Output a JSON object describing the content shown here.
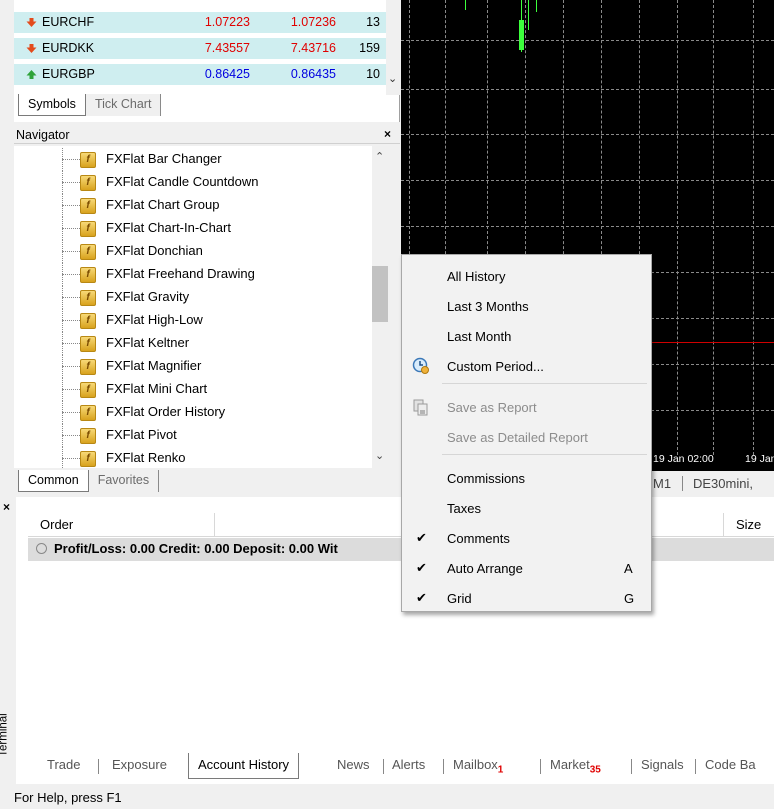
{
  "market_watch": {
    "rows": [
      {
        "symbol": "EURCHF",
        "direction": "down",
        "bid": "1.07223",
        "ask": "1.07236",
        "spread": "13",
        "color": "red"
      },
      {
        "symbol": "EURDKK",
        "direction": "down",
        "bid": "7.43557",
        "ask": "7.43716",
        "spread": "159",
        "color": "red"
      },
      {
        "symbol": "EURGBP",
        "direction": "up",
        "bid": "0.86425",
        "ask": "0.86435",
        "spread": "10",
        "color": "blue"
      }
    ],
    "tabs": [
      "Symbols",
      "Tick Chart"
    ]
  },
  "navigator": {
    "title": "Navigator",
    "items": [
      "FXFlat Bar Changer",
      "FXFlat Candle Countdown",
      "FXFlat Chart Group",
      "FXFlat Chart-In-Chart",
      "FXFlat Donchian",
      "FXFlat Freehand Drawing",
      "FXFlat Gravity",
      "FXFlat High-Low",
      "FXFlat Keltner",
      "FXFlat Magnifier",
      "FXFlat Mini Chart",
      "FXFlat Order History",
      "FXFlat Pivot",
      "FXFlat Renko"
    ],
    "tabs": [
      "Common",
      "Favorites"
    ]
  },
  "chart": {
    "time_labels": [
      "19 Jan 02:00",
      "19 Jan"
    ],
    "tabs": [
      "M1",
      "DE30mini,"
    ],
    "colors": {
      "background": "#000000",
      "grid": "#8a8a8a",
      "candle": "#3cff3c",
      "level": "#d00000"
    }
  },
  "context_menu": {
    "items": [
      {
        "label": "All History",
        "disabled": false,
        "checked": false,
        "shortcut": "",
        "icon": ""
      },
      {
        "label": "Last 3 Months",
        "disabled": false,
        "checked": false,
        "shortcut": "",
        "icon": ""
      },
      {
        "label": "Last Month",
        "disabled": false,
        "checked": false,
        "shortcut": "",
        "icon": ""
      },
      {
        "label": "Custom Period...",
        "disabled": false,
        "checked": false,
        "shortcut": "",
        "icon": "clock-icon"
      },
      {
        "label": "Save as Report",
        "disabled": true,
        "checked": false,
        "shortcut": "",
        "icon": "save-report-icon"
      },
      {
        "label": "Save as Detailed Report",
        "disabled": true,
        "checked": false,
        "shortcut": "",
        "icon": ""
      },
      {
        "label": "Commissions",
        "disabled": false,
        "checked": false,
        "shortcut": "",
        "icon": ""
      },
      {
        "label": "Taxes",
        "disabled": false,
        "checked": false,
        "shortcut": "",
        "icon": ""
      },
      {
        "label": "Comments",
        "disabled": false,
        "checked": true,
        "shortcut": "",
        "icon": ""
      },
      {
        "label": "Auto Arrange",
        "disabled": false,
        "checked": true,
        "shortcut": "A",
        "icon": ""
      },
      {
        "label": "Grid",
        "disabled": false,
        "checked": true,
        "shortcut": "G",
        "icon": ""
      }
    ]
  },
  "terminal": {
    "label": "Terminal",
    "columns": {
      "order": "Order",
      "size": "Size"
    },
    "summary": "Profit/Loss: 0.00  Credit: 0.00  Deposit: 0.00  Wit",
    "tabs": [
      {
        "label": "Trade",
        "badge": ""
      },
      {
        "label": "Exposure",
        "badge": ""
      },
      {
        "label": "Account History",
        "badge": ""
      },
      {
        "label": "News",
        "badge": ""
      },
      {
        "label": "Alerts",
        "badge": ""
      },
      {
        "label": "Mailbox",
        "badge": "1"
      },
      {
        "label": "Market",
        "badge": "35"
      },
      {
        "label": "Signals",
        "badge": ""
      },
      {
        "label": "Code Ba",
        "badge": ""
      }
    ]
  },
  "status_bar": {
    "text": "For Help, press F1"
  }
}
